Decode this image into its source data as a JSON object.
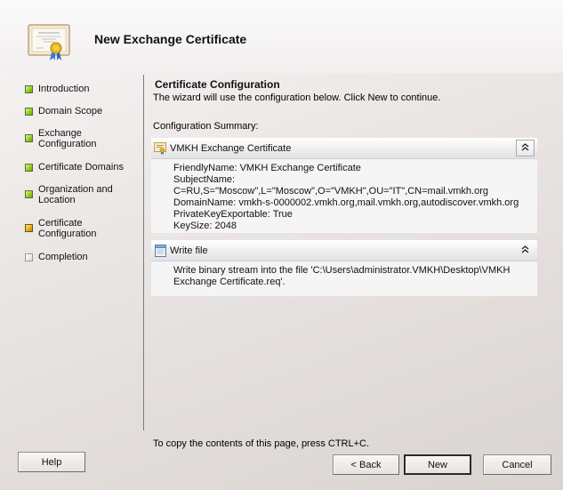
{
  "header": {
    "title": "New Exchange Certificate",
    "icon": "certificate-icon"
  },
  "nav": {
    "items": [
      {
        "label": "Introduction",
        "status": "completed"
      },
      {
        "label": "Domain Scope",
        "status": "completed"
      },
      {
        "label": "Exchange Configuration",
        "status": "completed"
      },
      {
        "label": "Certificate Domains",
        "status": "completed"
      },
      {
        "label": "Organization and Location",
        "status": "completed"
      },
      {
        "label": "Certificate Configuration",
        "status": "current"
      },
      {
        "label": "Completion",
        "status": "pending"
      }
    ],
    "lines": [
      [
        "Introduction"
      ],
      [
        "Domain Scope"
      ],
      [
        "Exchange",
        "Configuration"
      ],
      [
        "Certificate Domains"
      ],
      [
        "Organization and",
        "Location"
      ],
      [
        "Certificate",
        "Configuration"
      ],
      [
        "Completion"
      ]
    ]
  },
  "main": {
    "title": "Certificate Configuration",
    "description": "The wizard will use the configuration below.  Click New to continue.",
    "summary_label": "Configuration Summary:",
    "panels": [
      {
        "title": "VMKH Exchange Certificate",
        "icon": "certificate-icon",
        "collapse_glyph": "⌃⌃",
        "lines": [
          "FriendlyName: VMKH Exchange Certificate",
          "SubjectName:",
          "C=RU,S=\"Moscow\",L=\"Moscow\",O=\"VMKH\",OU=\"IT\",CN=mail.vmkh.org",
          "DomainName: vmkh-s-0000002.vmkh.org,mail.vmkh.org,autodiscover.vmkh.org",
          "PrivateKeyExportable: True",
          "KeySize: 2048"
        ]
      },
      {
        "title": "Write file",
        "icon": "notepad-file-icon",
        "collapse_glyph": "⌃⌃",
        "lines": [
          "Write binary stream into the file 'C:\\Users\\administrator.VMKH\\Desktop\\VMKH",
          "Exchange Certificate.req'."
        ]
      }
    ]
  },
  "footer": {
    "note": "To copy the contents of this page, press CTRL+C.",
    "help_label": "Help",
    "back_label": "< Back",
    "new_label": "New",
    "cancel_label": "Cancel"
  }
}
